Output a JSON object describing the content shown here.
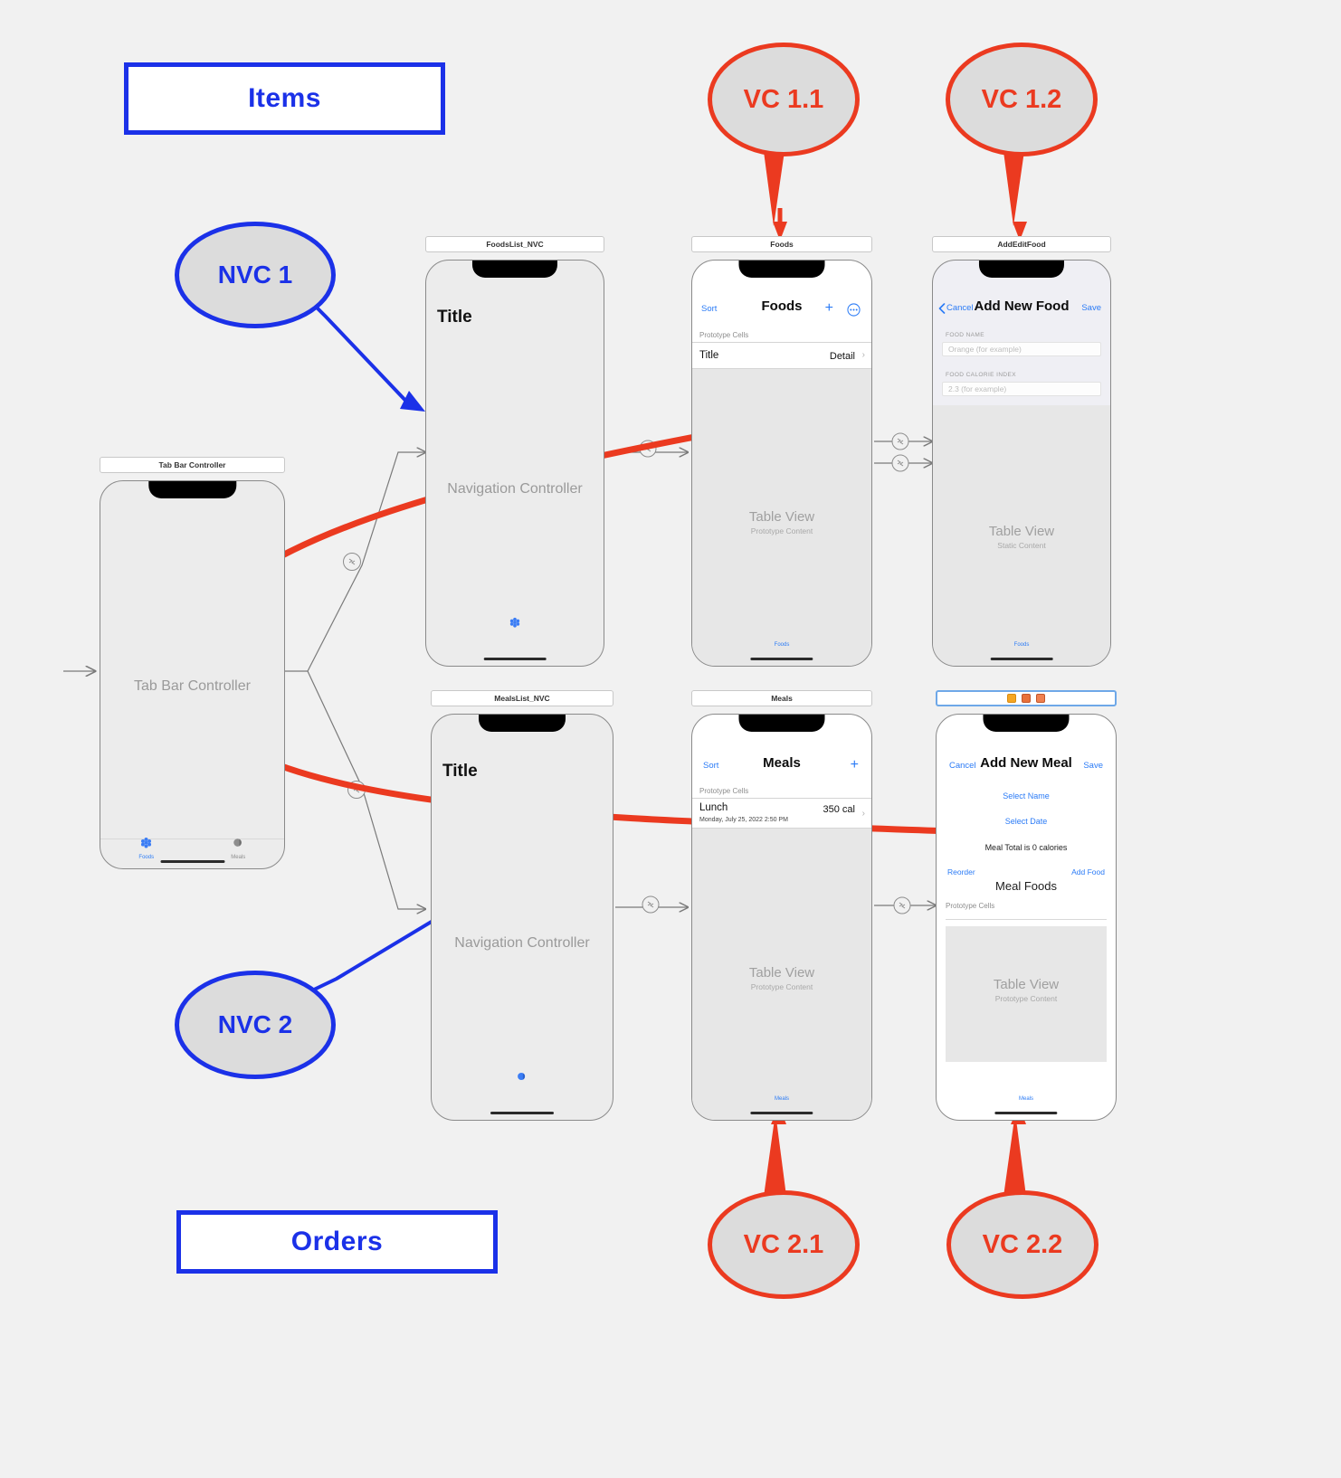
{
  "annotations": {
    "items_label": "Items",
    "orders_label": "Orders",
    "nvc1": "NVC 1",
    "nvc2": "NVC 2",
    "vc11": "VC 1.1",
    "vc12": "VC 1.2",
    "vc21": "VC 2.1",
    "vc22": "VC 2.2",
    "blue_color": "#1b31e8",
    "red_color": "#eb3a20"
  },
  "scenes": {
    "tabbar": {
      "label": "Tab Bar Controller",
      "center_text": "Tab Bar Controller",
      "tabs": [
        {
          "title": "Foods",
          "icon": "flower-icon"
        },
        {
          "title": "Meals",
          "icon": "circle-half-icon"
        }
      ]
    },
    "foodslist_nvc": {
      "label": "FoodsList_NVC",
      "title": "Title",
      "center_text": "Navigation Controller",
      "tab_icon": "flower-icon"
    },
    "foods": {
      "label": "Foods",
      "nav": {
        "left": "Sort",
        "title": "Foods",
        "add_icon": "plus-icon",
        "more_icon": "ellipsis-circle-icon"
      },
      "section_header": "Prototype Cells",
      "cell": {
        "title": "Title",
        "detail": "Detail",
        "chevron": "chevron-right-icon"
      },
      "tableview_title": "Table View",
      "tableview_sub": "Prototype Content",
      "tabbar_label": "Foods"
    },
    "addeditfood": {
      "label": "AddEditFood",
      "nav": {
        "back_icon": "chevron-left-icon",
        "left": "Cancel",
        "title": "Add New Food",
        "right": "Save"
      },
      "fields": [
        {
          "label": "FOOD NAME",
          "placeholder": "Orange (for example)"
        },
        {
          "label": "FOOD CALORIE INDEX",
          "placeholder": "2.3 (for example)"
        }
      ],
      "tableview_title": "Table View",
      "tableview_sub": "Static Content",
      "tabbar_label": "Foods"
    },
    "mealslist_nvc": {
      "label": "MealsList_NVC",
      "title": "Title",
      "center_text": "Navigation Controller",
      "tab_icon": "circle-half-icon"
    },
    "meals": {
      "label": "Meals",
      "nav": {
        "left": "Sort",
        "title": "Meals",
        "add_icon": "plus-icon"
      },
      "section_header": "Prototype Cells",
      "cell": {
        "title": "Lunch",
        "subtitle": "Monday, July 25, 2022 2:50 PM",
        "detail": "350 cal",
        "chevron": "chevron-right-icon"
      },
      "tableview_title": "Table View",
      "tableview_sub": "Prototype Content",
      "tabbar_label": "Meals"
    },
    "addnewmeal": {
      "label": "",
      "badges": [
        "warning-badge-icon",
        "error-badge-icon",
        "error-badge-icon"
      ],
      "nav": {
        "left": "Cancel",
        "title": "Add New Meal",
        "right": "Save"
      },
      "select_name": "Select Name",
      "select_date": "Select Date",
      "meal_total": "Meal Total is 0 calories",
      "reorder": "Reorder",
      "add_food": "Add Food",
      "meal_foods": "Meal Foods",
      "section_header": "Prototype Cells",
      "tableview_title": "Table View",
      "tableview_sub": "Prototype Content",
      "tabbar_label": "Meals"
    }
  },
  "segues": {
    "relationship_icon": "relationship-segue-icon",
    "show_icon": "show-segue-icon",
    "entry_arrow_icon": "entry-point-arrow-icon"
  }
}
